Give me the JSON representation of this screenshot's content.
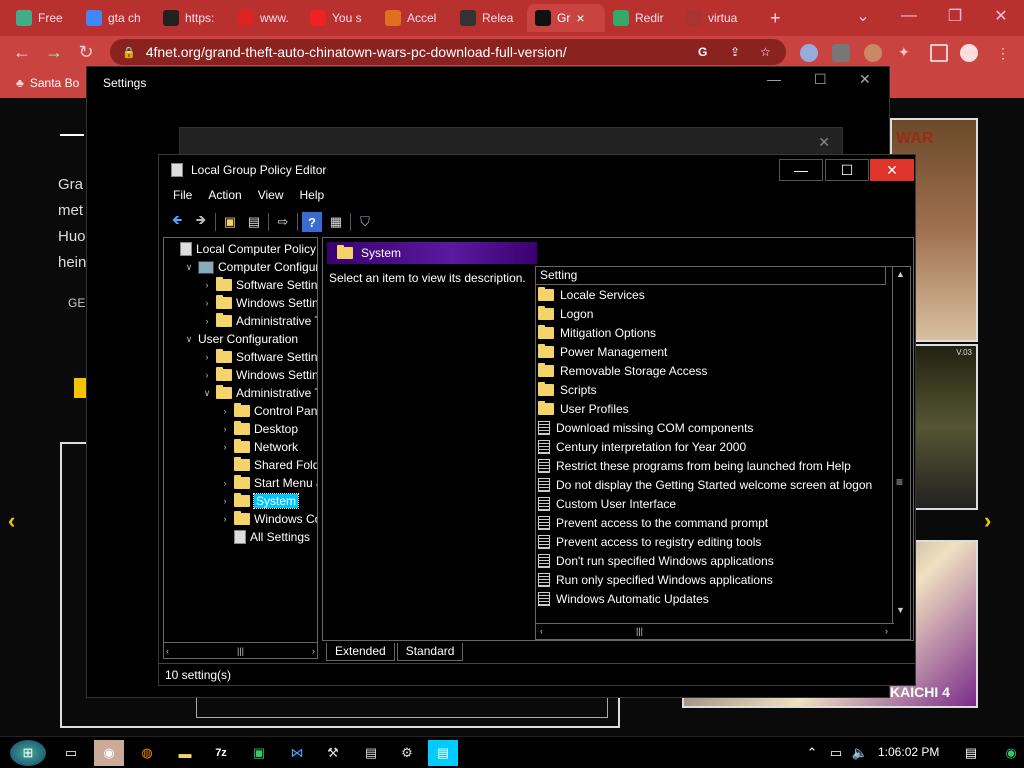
{
  "browser": {
    "tabs": [
      {
        "label": "Free",
        "color": "#4a8"
      },
      {
        "label": "gta ch",
        "color": "#4285f4"
      },
      {
        "label": "https:",
        "color": "#222"
      },
      {
        "label": "www.",
        "color": "#d22"
      },
      {
        "label": "You s",
        "color": "#e22"
      },
      {
        "label": "Accel",
        "color": "#e07020"
      },
      {
        "label": "Relea",
        "color": "#333"
      },
      {
        "label": "Gr",
        "color": "#111"
      },
      {
        "label": "Redir",
        "color": "#3a6"
      },
      {
        "label": "virtua",
        "color": "#a33"
      }
    ],
    "tab_close": "×",
    "new_tab": "+",
    "url": "4fnet.org/grand-theft-auto-chinatown-wars-pc-download-full-version/",
    "bookmark": "Santa Bo"
  },
  "page": {
    "left_text": [
      "Gra",
      "met",
      "Huo",
      "hein"
    ],
    "left_btn": "GE",
    "right_card_title": "WAR",
    "right_card_caption": "KAICHI 4",
    "right_card_mid": "V.03"
  },
  "settings": {
    "title": "Settings"
  },
  "gpedit": {
    "title": "Local Group Policy Editor",
    "menu": [
      "File",
      "Action",
      "View",
      "Help"
    ],
    "tree": [
      {
        "label": "Local Computer Policy",
        "indent": 0,
        "icon": "doc",
        "chev": ""
      },
      {
        "label": "Computer Configura",
        "indent": 1,
        "icon": "pc",
        "chev": "∨"
      },
      {
        "label": "Software Settings",
        "indent": 2,
        "icon": "folder",
        "chev": "›"
      },
      {
        "label": "Windows Setting",
        "indent": 2,
        "icon": "folder",
        "chev": "›"
      },
      {
        "label": "Administrative Te",
        "indent": 2,
        "icon": "folder",
        "chev": "›"
      },
      {
        "label": "User Configuration",
        "indent": 1,
        "icon": "none",
        "chev": "∨"
      },
      {
        "label": "Software Settings",
        "indent": 2,
        "icon": "folder",
        "chev": "›"
      },
      {
        "label": "Windows Setting",
        "indent": 2,
        "icon": "folder",
        "chev": "›"
      },
      {
        "label": "Administrative Te",
        "indent": 2,
        "icon": "folder",
        "chev": "∨"
      },
      {
        "label": "Control Panel",
        "indent": 3,
        "icon": "folder",
        "chev": "›"
      },
      {
        "label": "Desktop",
        "indent": 3,
        "icon": "folder",
        "chev": "›"
      },
      {
        "label": "Network",
        "indent": 3,
        "icon": "folder",
        "chev": "›"
      },
      {
        "label": "Shared Folder",
        "indent": 3,
        "icon": "folder",
        "chev": ""
      },
      {
        "label": "Start Menu ar",
        "indent": 3,
        "icon": "folder",
        "chev": "›"
      },
      {
        "label": "System",
        "indent": 3,
        "icon": "folder",
        "chev": "›",
        "selected": true
      },
      {
        "label": "Windows Cor",
        "indent": 3,
        "icon": "folder",
        "chev": "›"
      },
      {
        "label": "All Settings",
        "indent": 3,
        "icon": "doc",
        "chev": ""
      }
    ],
    "header": "System",
    "description": "Select an item to view its description.",
    "column": "Setting",
    "items": [
      {
        "label": "Locale Services",
        "type": "folder"
      },
      {
        "label": "Logon",
        "type": "folder"
      },
      {
        "label": "Mitigation Options",
        "type": "folder"
      },
      {
        "label": "Power Management",
        "type": "folder"
      },
      {
        "label": "Removable Storage Access",
        "type": "folder"
      },
      {
        "label": "Scripts",
        "type": "folder"
      },
      {
        "label": "User Profiles",
        "type": "folder"
      },
      {
        "label": "Download missing COM components",
        "type": "setting"
      },
      {
        "label": "Century interpretation for Year 2000",
        "type": "setting"
      },
      {
        "label": "Restrict these programs from being launched from Help",
        "type": "setting"
      },
      {
        "label": "Do not display the Getting Started welcome screen at logon",
        "type": "setting"
      },
      {
        "label": "Custom User Interface",
        "type": "setting"
      },
      {
        "label": "Prevent access to the command prompt",
        "type": "setting"
      },
      {
        "label": "Prevent access to registry editing tools",
        "type": "setting"
      },
      {
        "label": "Don't run specified Windows applications",
        "type": "setting"
      },
      {
        "label": "Run only specified Windows applications",
        "type": "setting"
      },
      {
        "label": "Windows Automatic Updates",
        "type": "setting"
      }
    ],
    "tab_extended": "Extended",
    "tab_standard": "Standard",
    "status": "10 setting(s)"
  },
  "taskbar": {
    "clock": "1:06:02 PM",
    "app_7z": "7z"
  }
}
